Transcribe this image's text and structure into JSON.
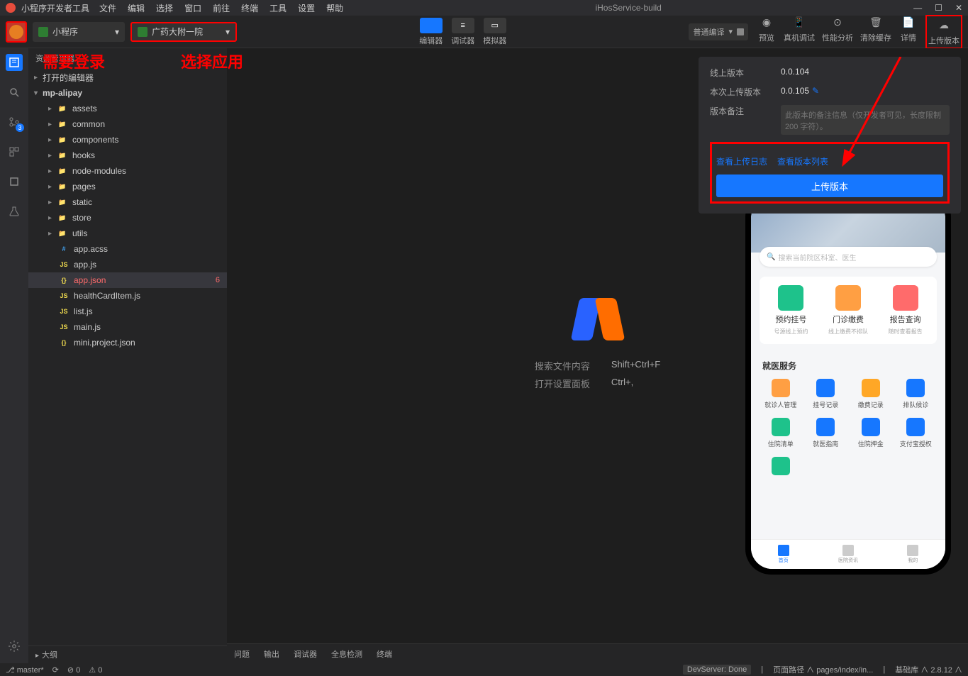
{
  "titlebar": {
    "app_name": "小程序开发者工具",
    "menus": [
      "文件",
      "编辑",
      "选择",
      "窗口",
      "前往",
      "终端",
      "工具",
      "设置",
      "帮助"
    ],
    "project": "iHosService-build"
  },
  "toolbar": {
    "dd1_label": "小程序",
    "dd2_label": "广药大附一院",
    "center": [
      {
        "label": "编辑器",
        "active": true
      },
      {
        "label": "调试器",
        "active": false
      },
      {
        "label": "模拟器",
        "active": false
      }
    ],
    "compile_label": "普通编译",
    "right": [
      {
        "label": "预览"
      },
      {
        "label": "真机调试"
      },
      {
        "label": "性能分析"
      },
      {
        "label": "清除缓存"
      },
      {
        "label": "详情"
      },
      {
        "label": "上传版本"
      }
    ]
  },
  "annotations": {
    "login": "需要登录",
    "select_app": "选择应用"
  },
  "sidebar": {
    "title": "资源管理器",
    "open_editors": "打开的编辑器",
    "root": "mp-alipay",
    "folders": [
      "assets",
      "common",
      "components",
      "hooks",
      "node-modules",
      "pages",
      "static",
      "store",
      "utils"
    ],
    "files": [
      {
        "name": "app.acss",
        "type": "css"
      },
      {
        "name": "app.js",
        "type": "js"
      },
      {
        "name": "app.json",
        "type": "json",
        "selected": true,
        "badge": "6"
      },
      {
        "name": "healthCardItem.js",
        "type": "js"
      },
      {
        "name": "list.js",
        "type": "js"
      },
      {
        "name": "main.js",
        "type": "js"
      },
      {
        "name": "mini.project.json",
        "type": "json"
      }
    ],
    "outline": "大纲"
  },
  "activitybar_badge": "3",
  "editor": {
    "hint1_label": "搜索文件内容",
    "hint1_key": "Shift+Ctrl+F",
    "hint2_label": "打开设置面板",
    "hint2_key": "Ctrl+,"
  },
  "panel_tabs": [
    "问题",
    "输出",
    "调试器",
    "全息检测",
    "终端"
  ],
  "upload": {
    "online_label": "线上版本",
    "online_value": "0.0.104",
    "this_label": "本次上传版本",
    "this_value": "0.0.105",
    "note_label": "版本备注",
    "note_placeholder": "此版本的备注信息（仅开发者可见，长度限制 200 字符）。",
    "link1": "查看上传日志",
    "link2": "查看版本列表",
    "button": "上传版本"
  },
  "simulator": {
    "search_placeholder": "搜索当前院区科室、医生",
    "big_items": [
      {
        "title": "预约挂号",
        "sub": "号源线上预约",
        "color": "#1ec28b"
      },
      {
        "title": "门诊缴费",
        "sub": "线上缴费不排队",
        "color": "#ff9f43"
      },
      {
        "title": "报告查询",
        "sub": "随时查看报告",
        "color": "#ff6b6b"
      }
    ],
    "section_title": "就医服务",
    "grid": [
      {
        "t": "就诊人管理",
        "c": "#ff9f43"
      },
      {
        "t": "挂号记录",
        "c": "#1677ff"
      },
      {
        "t": "缴费记录",
        "c": "#ffa726"
      },
      {
        "t": "排队候诊",
        "c": "#1677ff"
      },
      {
        "t": "住院清单",
        "c": "#1ec28b"
      },
      {
        "t": "就医指南",
        "c": "#1677ff"
      },
      {
        "t": "住院押金",
        "c": "#1677ff"
      },
      {
        "t": "支付宝授权",
        "c": "#1677ff"
      },
      {
        "t": "",
        "c": "#1ec28b"
      }
    ],
    "tabs": [
      {
        "t": "首页",
        "active": true
      },
      {
        "t": "医院资讯",
        "active": false
      },
      {
        "t": "我的",
        "active": false
      }
    ]
  },
  "statusbar": {
    "branch": "master*",
    "errors": "0",
    "warnings": "0",
    "devserver": "DevServer: Done",
    "route_label": "页面路径",
    "route_value": "pages/index/in...",
    "lib_label": "基础库",
    "lib_value": "2.8.12"
  }
}
